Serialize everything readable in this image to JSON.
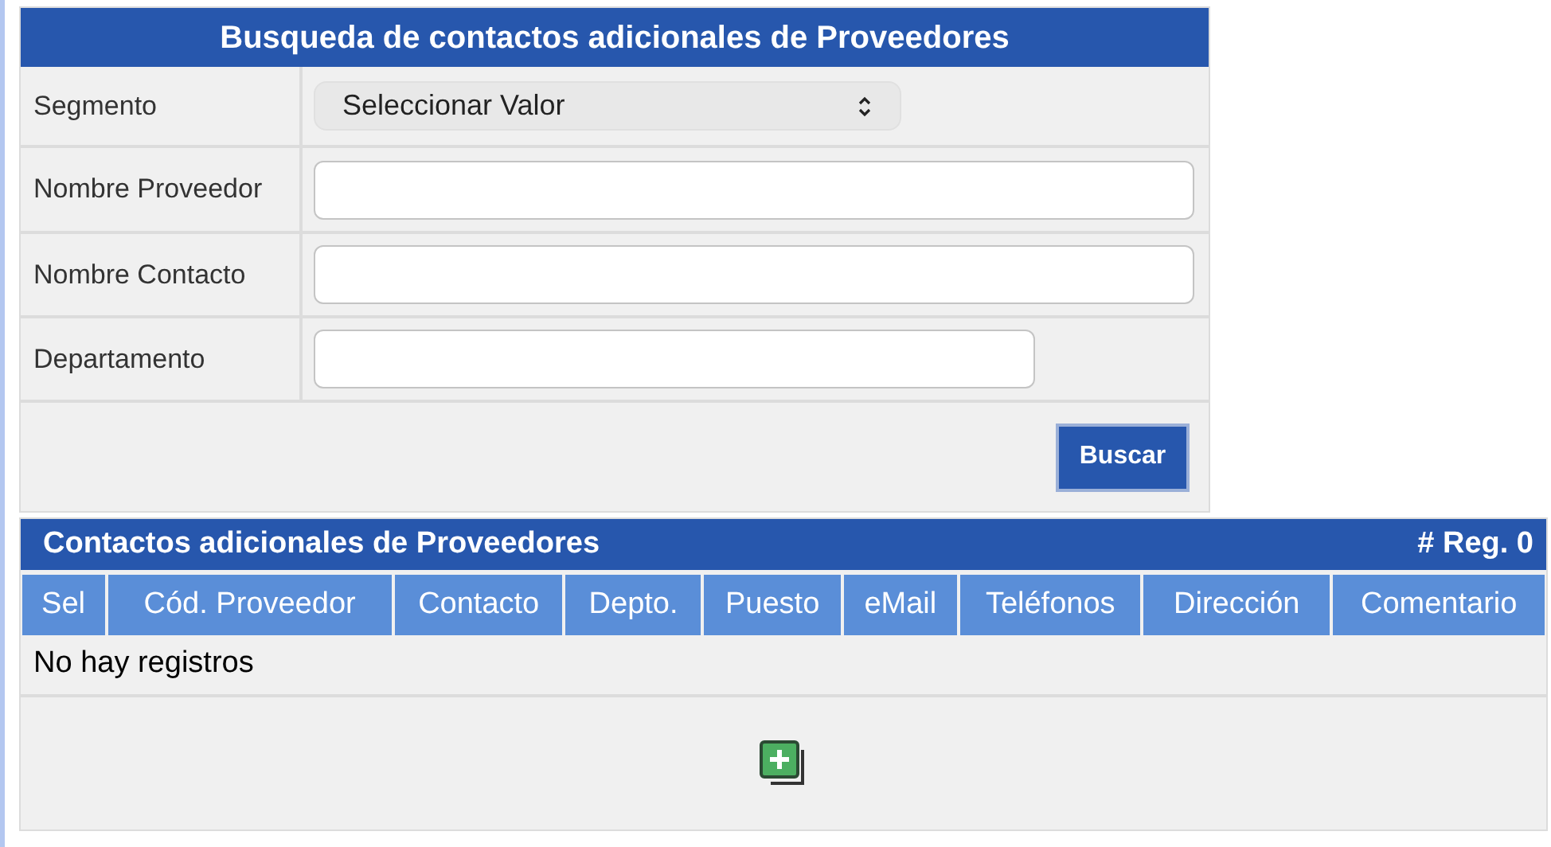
{
  "search_panel": {
    "title": "Busqueda de contactos adicionales de Proveedores",
    "fields": [
      {
        "label": "Segmento",
        "kind": "select",
        "value": "Seleccionar Valor"
      },
      {
        "label": "Nombre Proveedor",
        "kind": "text"
      },
      {
        "label": "Nombre Contacto",
        "kind": "text"
      },
      {
        "label": "Departamento",
        "kind": "short_text"
      }
    ],
    "button": "Buscar"
  },
  "results_panel": {
    "title": "Contactos adicionales de Proveedores",
    "count": "# Reg. 0",
    "columns": [
      "Sel",
      "Cód. Proveedor",
      "Contacto",
      "Depto.",
      "Puesto",
      "eMail",
      "Teléfonos",
      "Dirección",
      "Comentario"
    ],
    "empty_message": "No hay registros"
  }
}
